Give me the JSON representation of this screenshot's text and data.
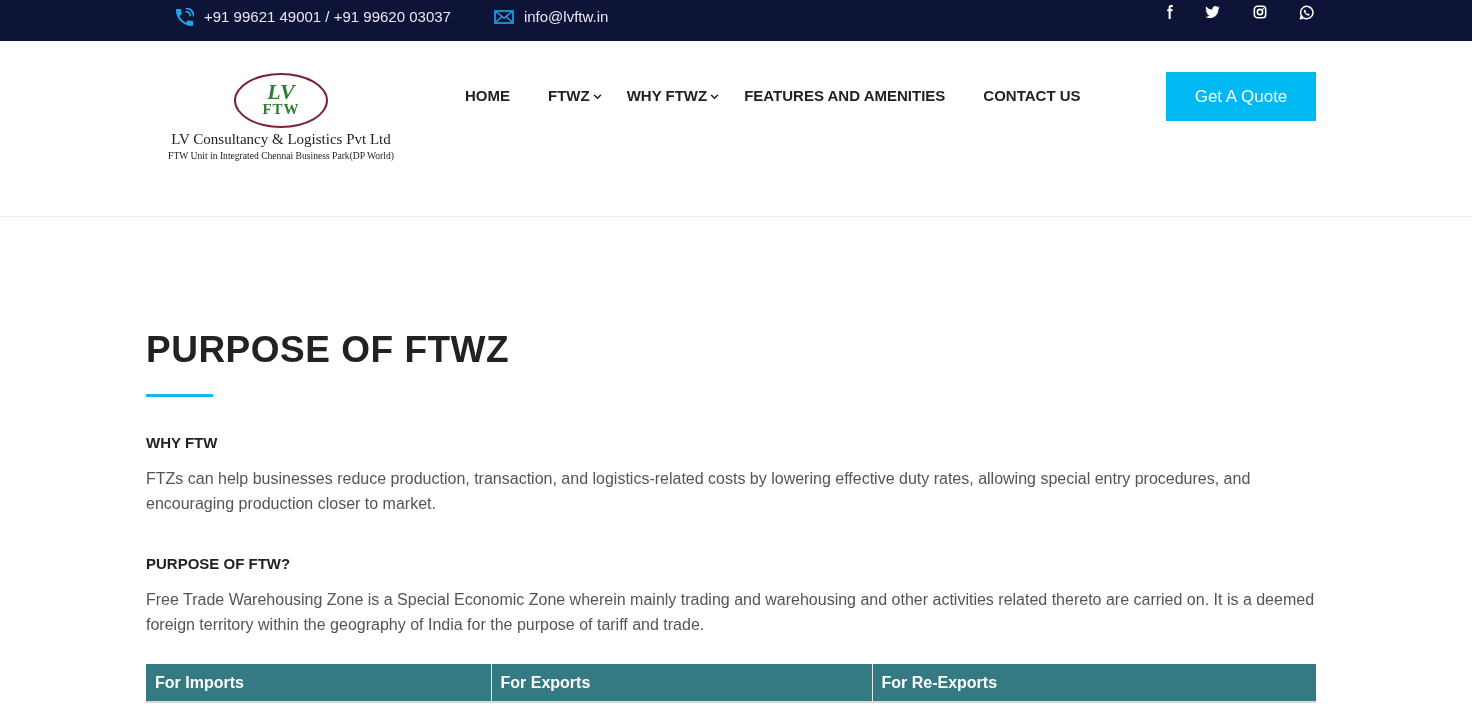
{
  "top_bar": {
    "contacts": [
      {
        "kind": "phone",
        "text": "+91 99621 49001 / +91 99620 03037"
      },
      {
        "kind": "email",
        "text": "info@lvftw.in"
      }
    ],
    "social_links": [
      {
        "kind": "facebook"
      },
      {
        "kind": "twitter"
      },
      {
        "kind": "instagram"
      },
      {
        "kind": "whatsapp"
      }
    ]
  },
  "header": {
    "logo": {
      "mark_top": "LV",
      "mark_bottom": "FTW",
      "company_name": "LV Consultancy & Logistics Pvt Ltd",
      "tagline": "FTW Unit in Integrated Chennai Business Park(DP World)"
    },
    "nav": [
      {
        "label": "HOME",
        "has_dropdown": false
      },
      {
        "label": "FTWZ",
        "has_dropdown": true
      },
      {
        "label": "WHY FTWZ",
        "has_dropdown": true
      },
      {
        "label": "FEATURES AND AMENITIES",
        "has_dropdown": false
      },
      {
        "label": "CONTACT US",
        "has_dropdown": false
      }
    ],
    "cta_button": "Get A Quote"
  },
  "main": {
    "title": "PURPOSE OF FTWZ",
    "sections": [
      {
        "heading": "WHY FTW",
        "text": "FTZs can help businesses reduce production, transaction, and logistics-related costs by lowering effective duty rates, allowing special entry procedures, and encouraging production closer to market."
      },
      {
        "heading": "PURPOSE OF FTW?",
        "text": "Free Trade Warehousing Zone is a Special Economic Zone wherein mainly trading and warehousing and other activities related thereto are carried on. It is a deemed foreign territory within the geography of India for the purpose of tariff and trade."
      }
    ],
    "table": {
      "columns": [
        "For Imports",
        "For Exports",
        "For Re-Exports"
      ]
    }
  }
}
